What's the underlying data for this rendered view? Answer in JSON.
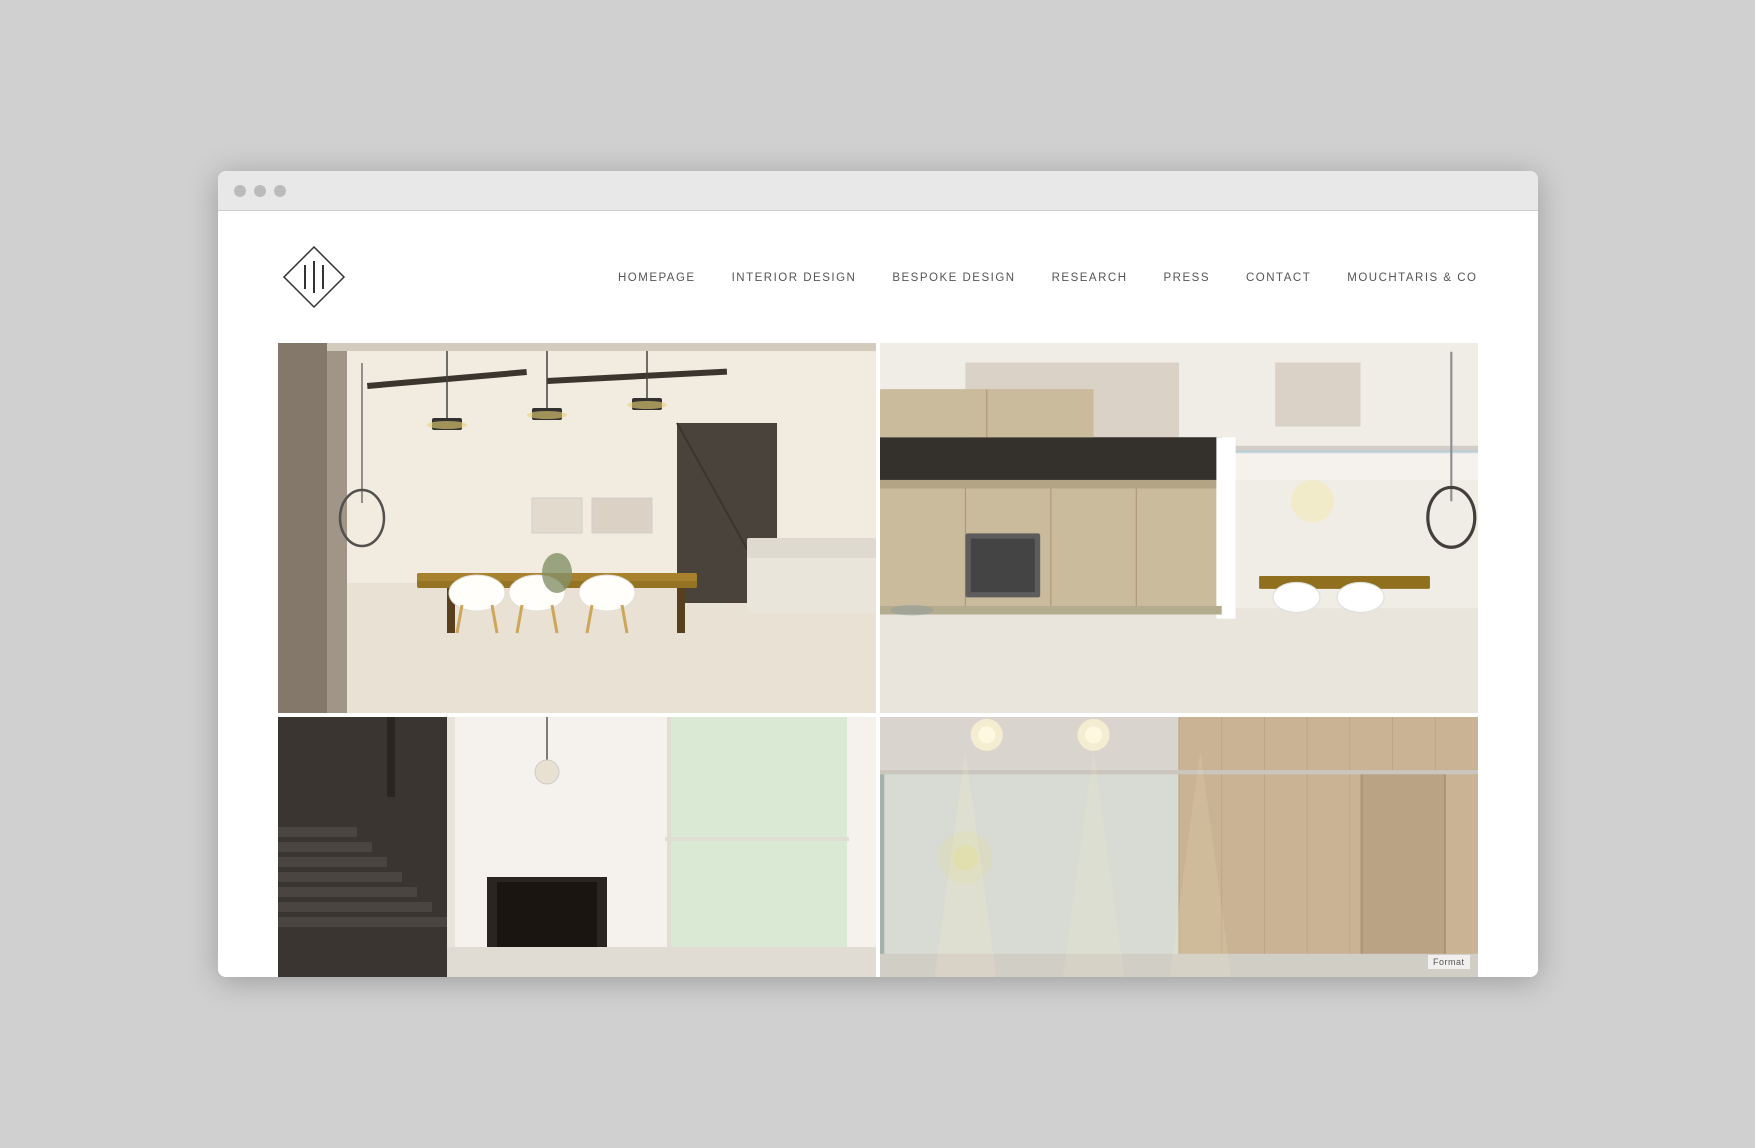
{
  "browser": {
    "dots": [
      "dot1",
      "dot2",
      "dot3"
    ]
  },
  "header": {
    "logo_text": "111",
    "logo_alt": "111 Studio Logo"
  },
  "nav": {
    "items": [
      {
        "id": "homepage",
        "label": "HOMEPAGE",
        "href": "#"
      },
      {
        "id": "interior-design",
        "label": "INTERIOR DESIGN",
        "href": "#"
      },
      {
        "id": "bespoke-design",
        "label": "BESPOKE DESIGN",
        "href": "#"
      },
      {
        "id": "research",
        "label": "RESEARCH",
        "href": "#"
      },
      {
        "id": "press",
        "label": "PRESS",
        "href": "#"
      },
      {
        "id": "contact",
        "label": "CONTACT",
        "href": "#"
      },
      {
        "id": "mouchtaris-co",
        "label": "MOUCHTARIS & CO",
        "href": "#"
      }
    ]
  },
  "gallery": {
    "images": [
      {
        "id": "room-1",
        "alt": "Modern open-plan living and dining room with warm wood tones",
        "position": "top-left"
      },
      {
        "id": "room-2",
        "alt": "Modern kitchen and open-plan living area with mezzanine",
        "position": "top-right"
      },
      {
        "id": "room-3",
        "alt": "Staircase and bright interior space",
        "position": "bottom-left"
      },
      {
        "id": "room-4",
        "alt": "Modern interior with wood paneling and recessed lighting",
        "position": "bottom-right"
      }
    ]
  },
  "footer": {
    "format_label": "Format"
  }
}
